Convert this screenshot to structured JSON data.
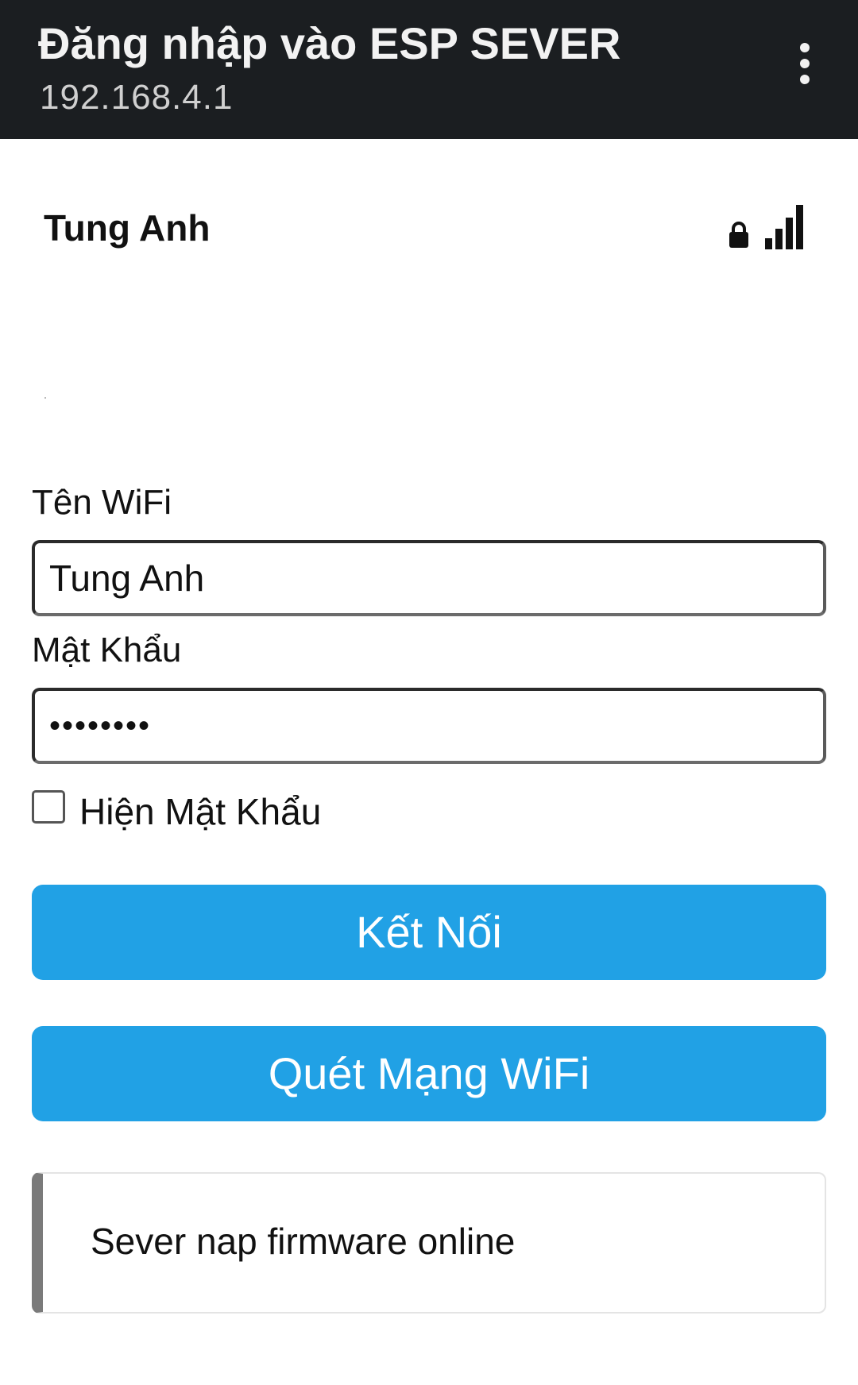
{
  "header": {
    "title": "Đăng nhập vào ESP SEVER",
    "subtitle": "192.168.4.1",
    "menu_icon": "more-vertical-icon"
  },
  "network": {
    "ssid": "Tung Anh",
    "secured_icon": "lock-icon",
    "signal_icon": "signal-bars-icon",
    "signal_level": 4
  },
  "form": {
    "ssid_label": "Tên WiFi",
    "ssid_value": "Tung Anh",
    "password_label": "Mật Khẩu",
    "password_value": "••••••••",
    "show_password_label": "Hiện Mật Khẩu",
    "show_password_checked": false
  },
  "buttons": {
    "connect_label": "Kết Nối",
    "scan_label": "Quét Mạng WiFi",
    "color": "#21a1e5"
  },
  "card": {
    "text": "Sever nap firmware online"
  }
}
